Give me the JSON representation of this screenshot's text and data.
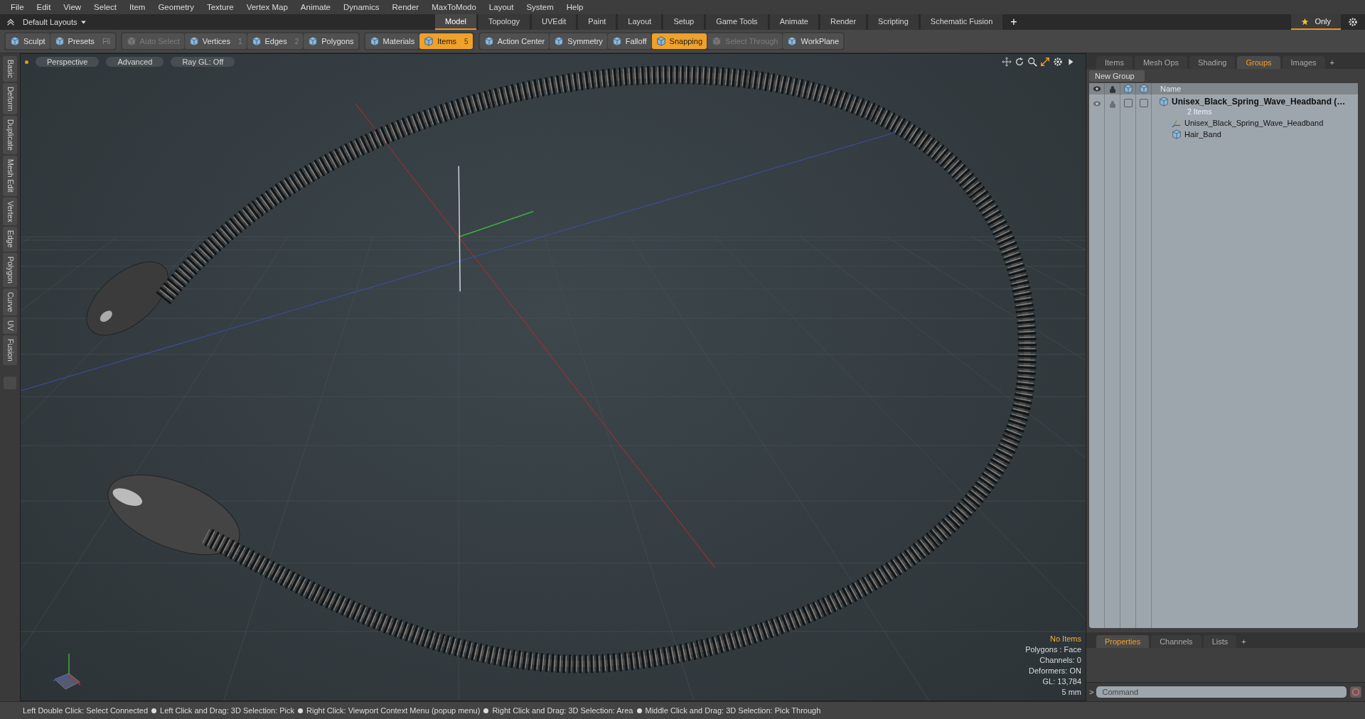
{
  "menu": [
    "File",
    "Edit",
    "View",
    "Select",
    "Item",
    "Geometry",
    "Texture",
    "Vertex Map",
    "Animate",
    "Dynamics",
    "Render",
    "MaxToModo",
    "Layout",
    "System",
    "Help"
  ],
  "layout_bar": {
    "layout_menu": "Default Layouts",
    "tabs": [
      {
        "label": "Model",
        "selected": true
      },
      {
        "label": "Topology",
        "selected": false
      },
      {
        "label": "UVEdit",
        "selected": false
      },
      {
        "label": "Paint",
        "selected": false
      },
      {
        "label": "Layout",
        "selected": false
      },
      {
        "label": "Setup",
        "selected": false
      },
      {
        "label": "Game Tools",
        "selected": false
      },
      {
        "label": "Animate",
        "selected": false
      },
      {
        "label": "Render",
        "selected": false
      },
      {
        "label": "Scripting",
        "selected": false
      },
      {
        "label": "Schematic Fusion",
        "selected": false
      }
    ],
    "add_tab": "+",
    "only_button": "Only"
  },
  "toolbar": [
    {
      "items": [
        {
          "label": "Sculpt",
          "selected": false,
          "disabled": false
        },
        {
          "label": "Presets",
          "shortcut": "F6",
          "selected": false,
          "disabled": false
        }
      ]
    },
    {
      "items": [
        {
          "label": "Auto Select",
          "selected": false,
          "disabled": true
        },
        {
          "label": "Vertices",
          "shortcut": "1",
          "selected": false,
          "disabled": false
        },
        {
          "label": "Edges",
          "shortcut": "2",
          "selected": false,
          "disabled": false
        },
        {
          "label": "Polygons",
          "selected": false,
          "disabled": false
        }
      ]
    },
    {
      "items": [
        {
          "label": "Materials",
          "selected": false,
          "disabled": false
        },
        {
          "label": "Items",
          "shortcut": "5",
          "selected": true,
          "disabled": false
        }
      ]
    },
    {
      "items": [
        {
          "label": "Action Center",
          "selected": false,
          "disabled": false
        },
        {
          "label": "Symmetry",
          "selected": false,
          "disabled": false
        },
        {
          "label": "Falloff",
          "selected": false,
          "disabled": false
        },
        {
          "label": "Snapping",
          "selected": true,
          "disabled": false
        },
        {
          "label": "Select Through",
          "selected": false,
          "disabled": true
        },
        {
          "label": "WorkPlane",
          "selected": false,
          "disabled": false
        }
      ]
    }
  ],
  "side_tabs": [
    "Basic",
    "Deform",
    "Duplicate",
    "Mesh Edit",
    "Vertex",
    "Edge",
    "Polygon",
    "Curve",
    "UV",
    "Fusion"
  ],
  "viewport": {
    "buttons": [
      "Perspective",
      "Advanced",
      "Ray GL: Off"
    ],
    "info": [
      {
        "text": "No Items",
        "kind": "highlight"
      },
      {
        "text": "Polygons : Face",
        "kind": "plain"
      },
      {
        "text": "Channels: 0",
        "kind": "plain"
      },
      {
        "text": "Deformers: ON",
        "kind": "plain"
      },
      {
        "text": "GL: 13,784",
        "kind": "plain"
      },
      {
        "text": "5 mm",
        "kind": "plain"
      }
    ]
  },
  "right_panel": {
    "tabs": [
      {
        "label": "Items",
        "selected": false
      },
      {
        "label": "Mesh Ops",
        "selected": false
      },
      {
        "label": "Shading",
        "selected": false
      },
      {
        "label": "Groups",
        "selected": true
      },
      {
        "label": "Images",
        "selected": false
      }
    ],
    "add_tab": "+",
    "new_group_button": "New Group",
    "name_column": "Name",
    "tree": [
      {
        "label": "Unisex_Black_Spring_Wave_Headband (…",
        "count": "2 Items",
        "kind": "group",
        "children": [
          {
            "label": "Unisex_Black_Spring_Wave_Headband",
            "kind": "locator"
          },
          {
            "label": "Hair_Band",
            "kind": "mesh"
          }
        ]
      }
    ],
    "bottom_tabs": [
      {
        "label": "Properties",
        "selected": true
      },
      {
        "label": "Channels",
        "selected": false
      },
      {
        "label": "Lists",
        "selected": false
      }
    ],
    "bottom_add_tab": "+",
    "command": {
      "prompt": ">",
      "placeholder": "Command"
    }
  },
  "status_bar": [
    "Left Double Click: Select Connected",
    "Left Click and Drag: 3D Selection: Pick",
    "Right Click: Viewport Context Menu (popup menu)",
    "Right Click and Drag: 3D Selection: Area",
    "Middle Click and Drag: 3D Selection: Pick Through"
  ]
}
